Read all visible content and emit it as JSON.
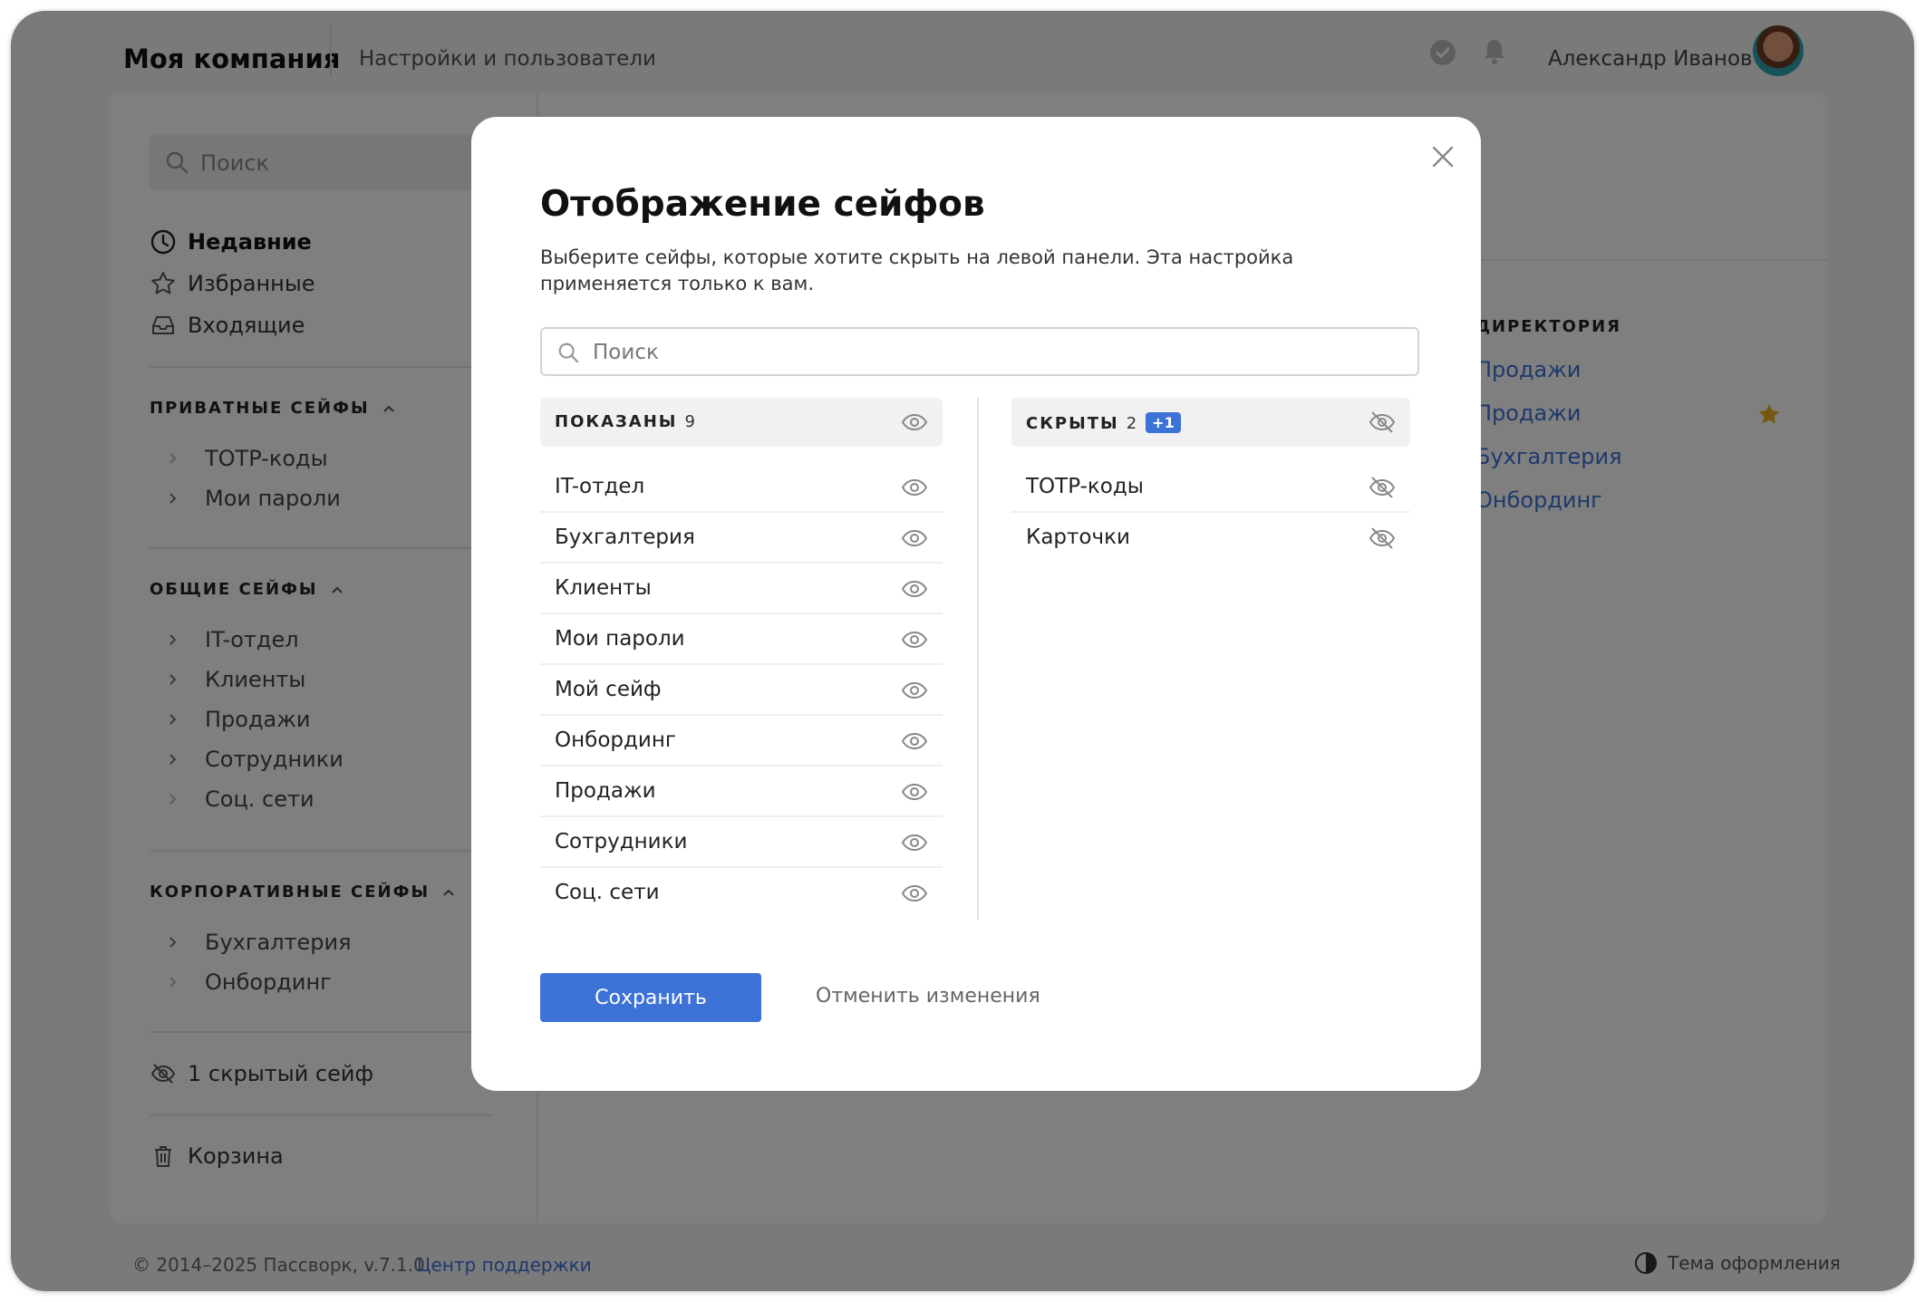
{
  "header": {
    "company": "Моя компания",
    "breadcrumb": "Настройки и пользователи",
    "user_name": "Александр Иванов"
  },
  "sidebar": {
    "search_placeholder": "Поиск",
    "nav": [
      "Недавние",
      "Избранные",
      "Входящие"
    ],
    "private_title": "ПРИВАТНЫЕ СЕЙФЫ",
    "private_items": [
      "TOTP-коды",
      "Мои пароли"
    ],
    "shared_title": "ОБЩИЕ СЕЙФЫ",
    "shared_items": [
      "IT-отдел",
      "Клиенты",
      "Продажи",
      "Сотрудники",
      "Соц. сети"
    ],
    "corp_title": "КОРПОРАТИВНЫЕ СЕЙФЫ",
    "corp_items": [
      "Бухгалтерия",
      "Онбординг"
    ],
    "hidden_label": "1 скрытый сейф",
    "trash_label": "Корзина"
  },
  "directory": {
    "title": "ДИРЕКТОРИЯ",
    "links": [
      "Продажи",
      "Продажи",
      "Бухгалтерия",
      "Онбординг"
    ]
  },
  "footer": {
    "copyright": "© 2014–2025 Пассворк, v.7.1.0",
    "support": "Центр поддержки",
    "theme": "Тема оформления"
  },
  "modal": {
    "title": "Отображение сейфов",
    "description": "Выберите сейфы, которые хотите скрыть на левой панели. Эта настройка применяется только к вам.",
    "search_placeholder": "Поиск",
    "shown_title": "ПОКАЗАНЫ",
    "shown_count": "9",
    "shown_items": [
      "IT-отдел",
      "Бухгалтерия",
      "Клиенты",
      "Мои пароли",
      "Мой сейф",
      "Онбординг",
      "Продажи",
      "Сотрудники",
      "Соц. сети"
    ],
    "hidden_title": "СКРЫТЫ",
    "hidden_count": "2",
    "hidden_badge": "+1",
    "hidden_items": [
      "TOTP-коды",
      "Карточки"
    ],
    "save_label": "Сохранить",
    "cancel_label": "Отменить изменения"
  },
  "colors": {
    "accent": "#3d72d6",
    "star": "#e8b020"
  }
}
